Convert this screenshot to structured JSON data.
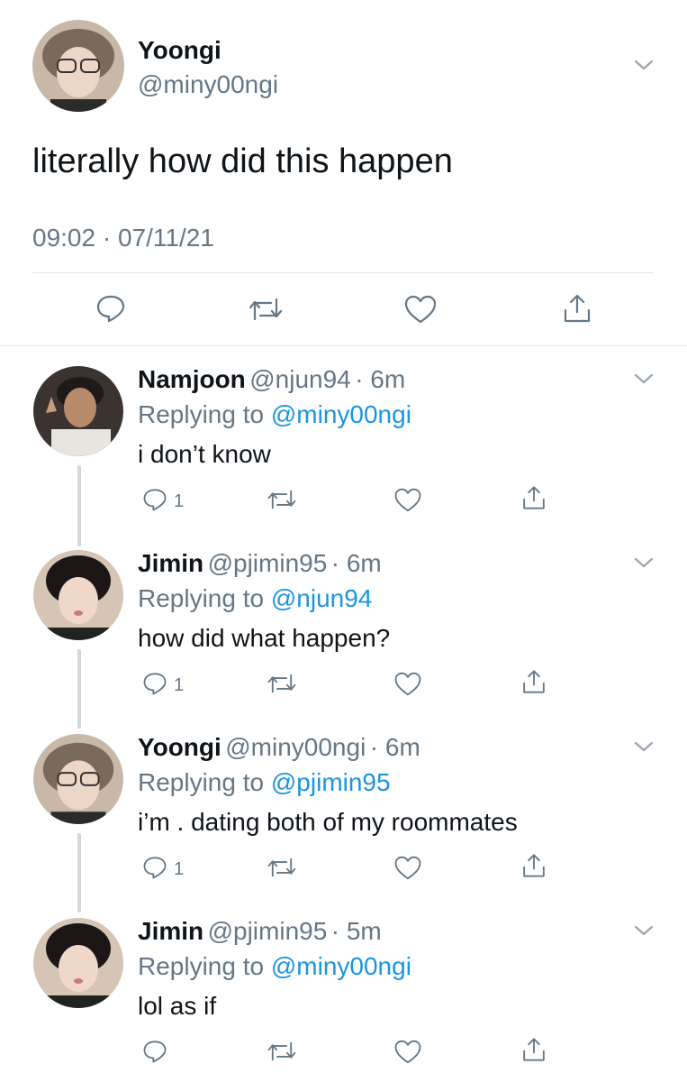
{
  "main_tweet": {
    "display_name": "Yoongi",
    "handle": "@miny00ngi",
    "text": "literally how did this happen",
    "timestamp": "09:02 · 07/11/21"
  },
  "replies": [
    {
      "display_name": "Namjoon",
      "handle": "@njun94",
      "time": "· 6m",
      "replying_prefix": "Replying to",
      "replying_to": "@miny00ngi",
      "text": "i don’t know",
      "reply_count": "1"
    },
    {
      "display_name": "Jimin",
      "handle": "@pjimin95",
      "time": "· 6m",
      "replying_prefix": "Replying to",
      "replying_to": "@njun94",
      "text": "how did what happen?",
      "reply_count": "1"
    },
    {
      "display_name": "Yoongi",
      "handle": "@miny00ngi",
      "time": "· 6m",
      "replying_prefix": "Replying to",
      "replying_to": "@pjimin95",
      "text": "i’m . dating both of my roommates",
      "reply_count": "1"
    },
    {
      "display_name": "Jimin",
      "handle": "@pjimin95",
      "time": "· 5m",
      "replying_prefix": "Replying to",
      "replying_to": "@miny00ngi",
      "text": "lol as if",
      "reply_count": ""
    }
  ],
  "colors": {
    "link_blue": "#1b95e0",
    "secondary_gray": "#657786",
    "divider": "#e1e8ed",
    "thread_line": "#cfd9de"
  },
  "icons": [
    "reply-icon",
    "retweet-icon",
    "like-icon",
    "share-icon",
    "chevron-down-icon"
  ]
}
